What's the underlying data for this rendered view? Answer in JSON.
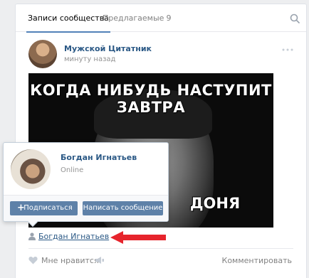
{
  "tabs": {
    "community_label": "Записи сообщества",
    "suggested_label": "Предлагаемые",
    "suggested_count": "9"
  },
  "post": {
    "author": "Мужской Цитатник",
    "time": "минуту назад",
    "image_text_top": "КОГДА НИБУДЬ НАСТУПИТ ЗАВТРА",
    "image_text_bottom": "ДОНЯ",
    "signer": "Богдан Игнатьев",
    "like_label": "Мне нравится",
    "comment_label": "Комментировать"
  },
  "popup": {
    "name": "Богдан Игнатьев",
    "status": "Online",
    "follow_label": "Подписаться",
    "message_label": "Написать сообщение"
  },
  "colors": {
    "link": "#2a5885",
    "accent": "#5181b8",
    "button": "#5e81a8",
    "arrow": "#e6242c"
  },
  "icons": [
    "search-icon",
    "more-icon",
    "person-icon",
    "heart-icon",
    "share-icon",
    "arrow-icon",
    "plus-icon"
  ]
}
